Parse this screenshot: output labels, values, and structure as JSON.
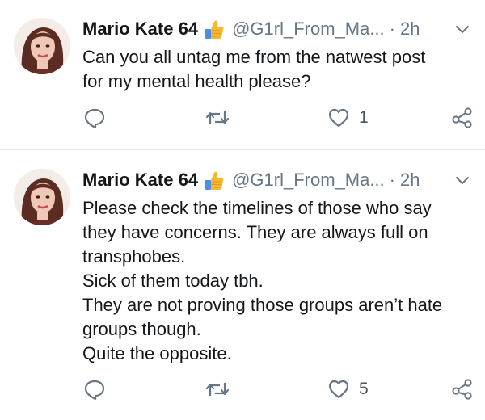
{
  "tweets": [
    {
      "display_name": "Mario Kate 64",
      "badge_emoji": "thumbs-up",
      "handle": "@G1rl_From_Ma...",
      "separator": "·",
      "time": "2h",
      "lines": [
        "Can you all untag me from the natwest post",
        "for my mental health please?"
      ],
      "like_count": "1"
    },
    {
      "display_name": "Mario Kate 64",
      "badge_emoji": "thumbs-up",
      "handle": "@G1rl_From_Ma...",
      "separator": "·",
      "time": "2h",
      "lines": [
        "Please check the timelines of those who say",
        "they have concerns. They are always full on",
        "transphobes.",
        "Sick of them today tbh.",
        "They are not proving those groups aren’t hate",
        "groups though.",
        "Quite the opposite."
      ],
      "like_count": "5"
    }
  ],
  "icons": {
    "reply": "reply-icon",
    "retweet": "retweet-icon",
    "like": "heart-icon",
    "share": "share-icon",
    "menu": "chevron-down-icon"
  },
  "colors": {
    "icon_gray": "#657786",
    "divider": "#e6ecf0",
    "badge_yellow": "#f5b82e",
    "badge_blue": "#4a90e2"
  }
}
